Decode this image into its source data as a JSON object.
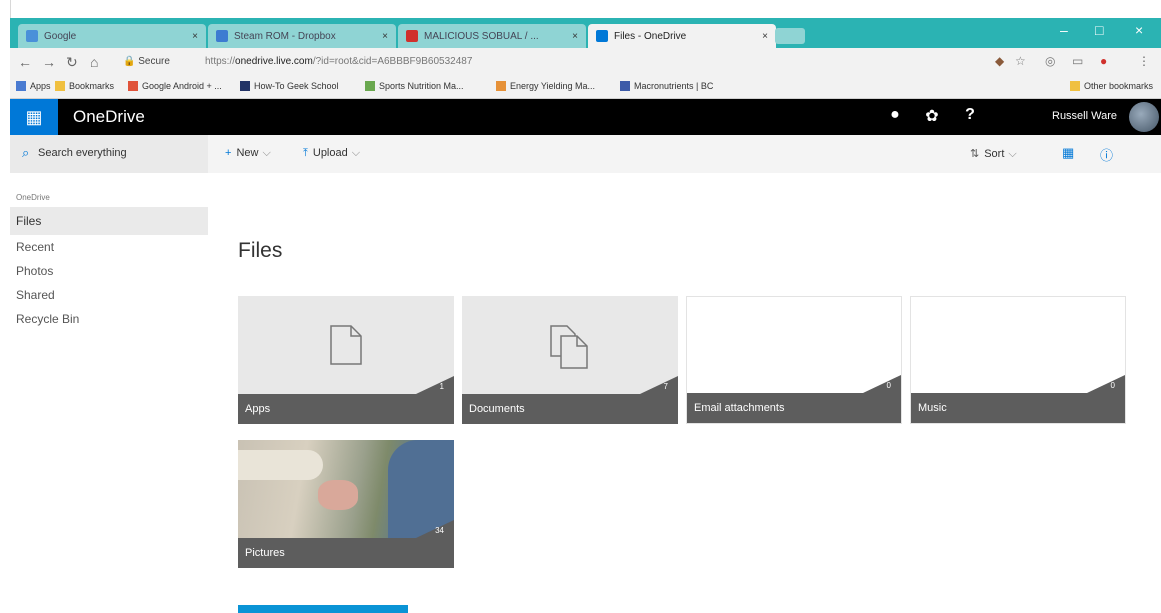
{
  "browser": {
    "tabs": [
      {
        "title": "Google",
        "fav_color": "#4a90d9",
        "active": false
      },
      {
        "title": "Steam ROM - Dropbox",
        "fav_color": "#3d7bd1",
        "active": false
      },
      {
        "title": "MALICIOUS SOBUAL / ...",
        "fav_color": "#d0312d",
        "active": false
      },
      {
        "title": "Files - OneDrive",
        "fav_color": "#0078d7",
        "active": true
      }
    ],
    "tab_close": "×",
    "window_controls": {
      "min": "–",
      "max": "□",
      "close": "×"
    },
    "secure_label": "Secure",
    "url_prefix": "https://",
    "url_host": "onedrive.live.com",
    "url_rest": "/?id=root&cid=A6BBBF9B60532487",
    "bookmarks": [
      {
        "label": "Apps",
        "color": "#4a7bd1"
      },
      {
        "label": "Bookmarks",
        "color": "#f0c040"
      },
      {
        "label": "Google Android + ...",
        "color": "#e0533a"
      },
      {
        "label": "How-To Geek School",
        "color": "#223366"
      },
      {
        "label": "Sports Nutrition Ma...",
        "color": "#6aa84f"
      },
      {
        "label": "Energy Yielding Ma...",
        "color": "#e69138"
      },
      {
        "label": "Macronutrients | BC",
        "color": "#3d5ba8"
      }
    ],
    "other_bookmarks": "Other bookmarks"
  },
  "onedrive": {
    "brand": "OneDrive",
    "user_name": "Russell Ware",
    "header_icons": [
      "chat-icon",
      "gear-icon",
      "help-icon"
    ]
  },
  "command_bar": {
    "search_placeholder": "Search everything",
    "new_label": "New",
    "upload_label": "Upload",
    "sort_label": "Sort"
  },
  "left_nav": {
    "header": "OneDrive",
    "items": [
      "Files",
      "Recent",
      "Photos",
      "Shared",
      "Recycle Bin"
    ],
    "selected": "Files"
  },
  "main": {
    "title": "Files",
    "folders": [
      {
        "name": "Apps",
        "count": "1"
      },
      {
        "name": "Documents",
        "count": "7"
      },
      {
        "name": "Email attachments",
        "count": "0"
      },
      {
        "name": "Music",
        "count": "0"
      },
      {
        "name": "Pictures",
        "count": "34"
      }
    ]
  },
  "colors": {
    "accent": "#0078d7",
    "tab_strip": "#2bb3b3",
    "tile_bar": "#5d5d5d"
  }
}
